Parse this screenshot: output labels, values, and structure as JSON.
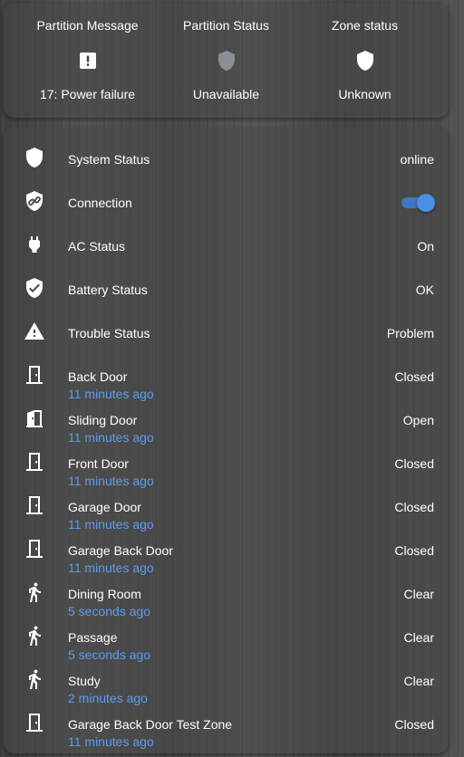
{
  "glance": [
    {
      "name": "Partition Message",
      "icon": "alert-box-icon",
      "state": "17: Power failure"
    },
    {
      "name": "Partition Status",
      "icon": "shield-grey-icon",
      "state": "Unavailable"
    },
    {
      "name": "Zone status",
      "icon": "shield-icon",
      "state": "Unknown"
    }
  ],
  "entities": [
    {
      "name": "System Status",
      "icon": "shield-icon",
      "state": "online"
    },
    {
      "name": "Connection",
      "icon": "shield-link-icon",
      "toggle_on": true
    },
    {
      "name": "AC Status",
      "icon": "power-plug-icon",
      "state": "On"
    },
    {
      "name": "Battery Status",
      "icon": "shield-check-icon",
      "state": "OK"
    },
    {
      "name": "Trouble Status",
      "icon": "warning-icon",
      "state": "Problem"
    },
    {
      "name": "Back Door",
      "secondary": "11 minutes ago",
      "icon": "door-closed-icon",
      "state": "Closed"
    },
    {
      "name": "Sliding Door",
      "secondary": "11 minutes ago",
      "icon": "door-open-icon",
      "state": "Open"
    },
    {
      "name": "Front Door",
      "secondary": "11 minutes ago",
      "icon": "door-closed-icon",
      "state": "Closed"
    },
    {
      "name": "Garage Door",
      "secondary": "11 minutes ago",
      "icon": "door-closed-icon",
      "state": "Closed"
    },
    {
      "name": "Garage Back Door",
      "secondary": "11 minutes ago",
      "icon": "door-closed-icon",
      "state": "Closed"
    },
    {
      "name": "Dining Room",
      "secondary": "5 seconds ago",
      "icon": "walk-icon",
      "state": "Clear"
    },
    {
      "name": "Passage",
      "secondary": "5 seconds ago",
      "icon": "walk-icon",
      "state": "Clear"
    },
    {
      "name": "Study",
      "secondary": "2 minutes ago",
      "icon": "walk-icon",
      "state": "Clear"
    },
    {
      "name": "Garage Back Door Test Zone",
      "secondary": "11 minutes ago",
      "icon": "door-closed-icon",
      "state": "Closed"
    }
  ],
  "colors": {
    "accent": "#4a90e2",
    "secondary_text": "#5b9cf0",
    "unavailable_icon": "#8a8f96"
  }
}
